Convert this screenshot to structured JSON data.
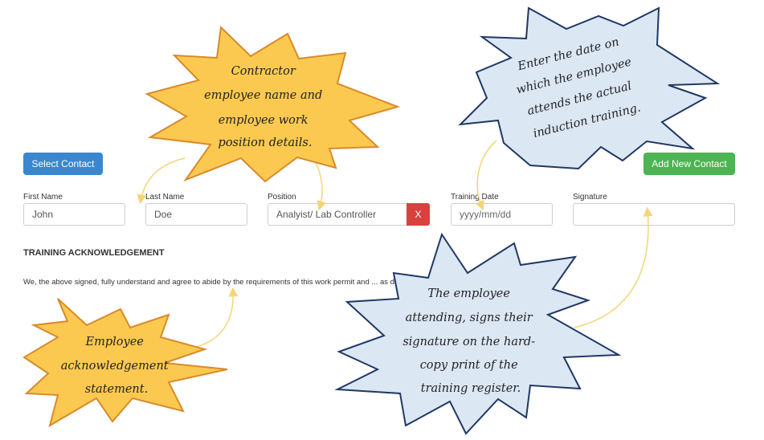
{
  "toolbar": {
    "select_contact_label": "Select Contact",
    "add_new_contact_label": "Add New Contact"
  },
  "fields": {
    "first_name": {
      "label": "First Name",
      "value": "John"
    },
    "last_name": {
      "label": "Last Name",
      "value": "Doe"
    },
    "position": {
      "label": "Position",
      "value": "Analyist/ Lab Controller",
      "remove_label": "X"
    },
    "training_date": {
      "label": "Training Date",
      "placeholder": "yyyy/mm/dd"
    },
    "signature": {
      "label": "Signature",
      "value": ""
    }
  },
  "section": {
    "title": "TRAINING ACKNOWLEDGEMENT",
    "statement": "We, the above signed, fully understand and agree to abide by the requirements of this work permit and ... as discussed in the safety induction given."
  },
  "callouts": {
    "contractor": [
      "Contractor",
      "employee name and",
      "employee work",
      "position details."
    ],
    "date": [
      "Enter the date on",
      "which the employee",
      "attends the actual",
      "induction training."
    ],
    "acknowledgement": [
      "Employee",
      "acknowledgement",
      "statement."
    ],
    "signature": [
      "The employee",
      "attending, signs their",
      "signature on the hard-",
      "copy print of the",
      "training register."
    ]
  },
  "colors": {
    "primary": "#3a87cf",
    "success": "#4cb453",
    "danger": "#d9413f",
    "callout_orange_fill": "#fbc950",
    "callout_orange_stroke": "#d98a2b",
    "callout_blue_fill": "#dce7f4",
    "callout_blue_stroke": "#1f3864",
    "arrow": "#f4d57a"
  }
}
